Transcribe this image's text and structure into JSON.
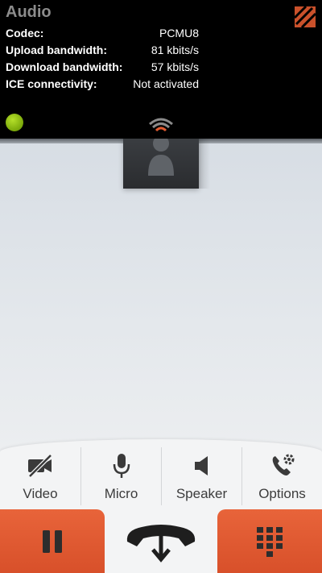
{
  "stats": {
    "title": "Audio",
    "rows": [
      {
        "label": "Codec:",
        "value": "PCMU8"
      },
      {
        "label": "Upload bandwidth:",
        "value": "81 kbits/s"
      },
      {
        "label": "Download bandwidth:",
        "value": "57 kbits/s"
      },
      {
        "label": "ICE connectivity:",
        "value": "Not activated"
      }
    ]
  },
  "controls": {
    "video_label": "Video",
    "micro_label": "Micro",
    "speaker_label": "Speaker",
    "options_label": "Options"
  },
  "icons": {
    "stats_toggle": "stats-toggle-icon",
    "status": "call-quality-dot",
    "signal": "signal-strength-icon",
    "avatar": "contact-avatar-icon",
    "video": "video-off-icon",
    "micro": "microphone-icon",
    "speaker": "speaker-icon",
    "options": "phone-settings-icon",
    "pause": "pause-icon",
    "hangup": "hang-up-icon",
    "dialpad": "dialpad-icon"
  },
  "colors": {
    "accent": "#e05a30",
    "status_ok": "#8cc414",
    "dark_icon": "#2d2d2d"
  }
}
